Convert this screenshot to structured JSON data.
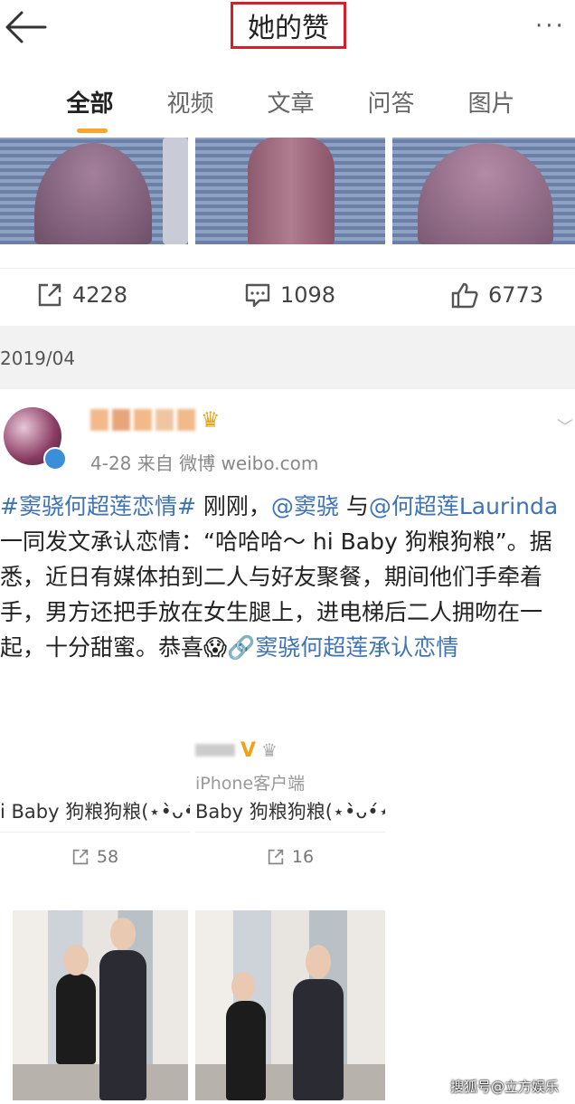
{
  "header": {
    "title": "她的赞",
    "more": "···"
  },
  "tabs": [
    {
      "label": "全部",
      "active": true
    },
    {
      "label": "视频"
    },
    {
      "label": "文章"
    },
    {
      "label": "问答"
    },
    {
      "label": "图片"
    }
  ],
  "prev_post_actions": {
    "repost_count": "4228",
    "comment_count": "1098",
    "like_count": "6773"
  },
  "date_separator": "2019/04",
  "post": {
    "meta": "4-28  来自 微博 weibo.com",
    "body": {
      "hashtag1": "#窦骁何超莲恋情#",
      "t1": " 刚刚，",
      "mention1": "@窦骁",
      "t2": " 与",
      "mention2": "@何超莲Laurinda",
      "t3": " 一同发文承认恋情：“哈哈哈～ hi Baby 狗粮狗粮”。据悉，近日有媒体拍到二人与好友聚餐，期间他们手牵着手，男方还把手放在女生腿上，进电梯后二人拥吻在一起，十分甜蜜。恭喜",
      "emoji": "😱",
      "link": "🔗窦骁何超莲承认恋情"
    }
  },
  "cards": [
    {
      "source": "",
      "text": "i Baby 狗粮狗粮(⋆•̀ᴗ•́⋆",
      "repost_count": "58"
    },
    {
      "source": "iPhone客户端",
      "text": "Baby 狗粮狗粮(⋆•̀ᴗ•́⋆",
      "repost_count": "16"
    }
  ],
  "watermark": "搜狐号@立方娱乐",
  "colors": {
    "accent_tab": "#f7a72b",
    "link": "#3f73b5",
    "title_box": "#d61f26"
  }
}
